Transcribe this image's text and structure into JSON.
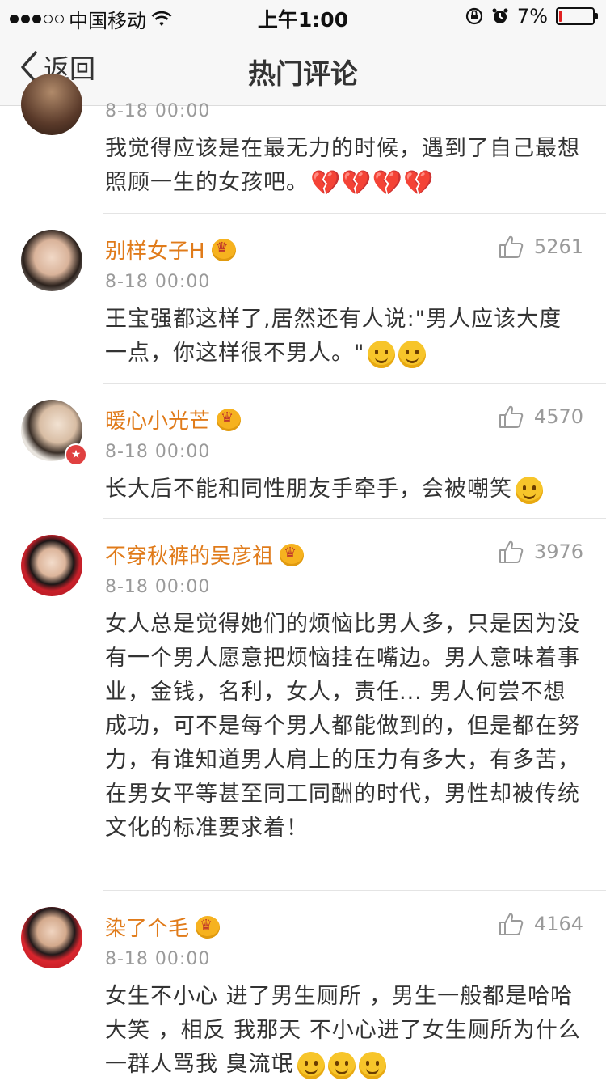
{
  "status_bar": {
    "carrier": "中国移动",
    "time": "上午1:00",
    "battery_percent": "7%",
    "battery_level": 0.07
  },
  "nav": {
    "back_label": "返回",
    "title": "热门评论"
  },
  "comments": [
    {
      "time": "8-18 00:00",
      "text": "我觉得应该是在最无力的时候，遇到了自己最想照顾一生的女孩吧。",
      "emoji": "💔💔💔💔"
    },
    {
      "username": "别样女子H",
      "likes": "5261",
      "time": "8-18 00:00",
      "text": "王宝强都这样了,居然还有人说:\"男人应该大度一点，你这样很不男人。\""
    },
    {
      "username": "暖心小光芒",
      "likes": "4570",
      "time": "8-18 00:00",
      "text": "长大后不能和同性朋友手牵手，会被嘲笑"
    },
    {
      "username": "不穿秋裤的吴彦祖",
      "likes": "3976",
      "time": "8-18 00:00",
      "text": "女人总是觉得她们的烦恼比男人多，只是因为没有一个男人愿意把烦恼挂在嘴边。男人意味着事业，金钱，名利，女人，责任... 男人何尝不想成功，可不是每个男人都能做到的，但是都在努力，有谁知道男人肩上的压力有多大，有多苦，在男女平等甚至同工同酬的时代，男性却被传统文化的标准要求着！"
    },
    {
      "username": "染了个毛",
      "likes": "4164",
      "time": "8-18 00:00",
      "text": "女生不小心 进了男生厕所 ，男生一般都是哈哈大笑 ，相反 我那天 不小心进了女生厕所为什么一群人骂我 臭流氓"
    }
  ]
}
